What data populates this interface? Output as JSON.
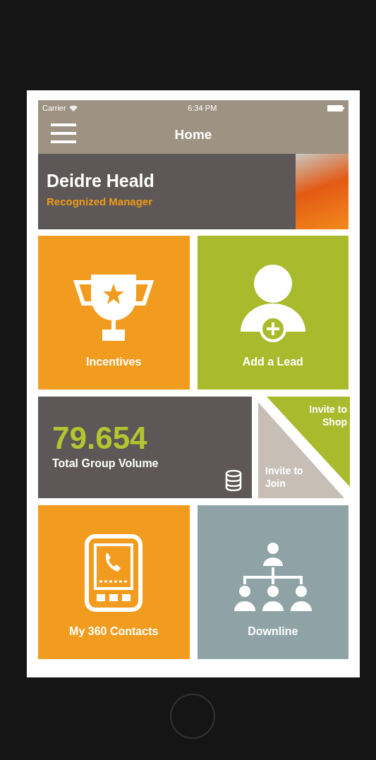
{
  "status_bar": {
    "carrier": "Carrier",
    "time": "6:34 PM"
  },
  "nav": {
    "title": "Home"
  },
  "profile": {
    "name": "Deidre Heald",
    "role": "Recognized Manager"
  },
  "rows": [
    {
      "tiles": [
        {
          "kind": "incentives",
          "label": "Incentives"
        },
        {
          "kind": "add_lead",
          "label": "Add a Lead"
        }
      ]
    },
    {
      "tiles": [
        {
          "kind": "volume",
          "value": "79.654",
          "label": "Total Group Volume"
        },
        {
          "kind": "invite",
          "upper": "Invite to Shop",
          "lower": "Invite to Join"
        }
      ]
    },
    {
      "tiles": [
        {
          "kind": "contacts",
          "label": "My 360 Contacts"
        },
        {
          "kind": "downline",
          "label": "Downline"
        }
      ]
    }
  ]
}
